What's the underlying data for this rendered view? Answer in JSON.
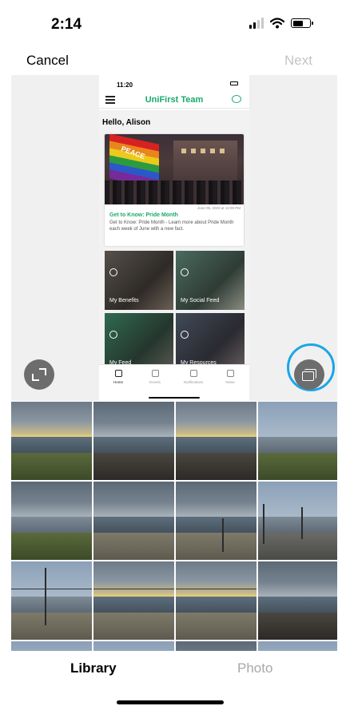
{
  "status_bar": {
    "time": "2:14"
  },
  "nav": {
    "cancel": "Cancel",
    "next": "Next"
  },
  "preview": {
    "status_time": "11:20",
    "app_title": "UniFirst Team",
    "greeting": "Hello, Alison",
    "card": {
      "flag_text": "PEACE",
      "date": "June 05, 2023 at 12:00 PM",
      "title": "Get to Know: Pride Month",
      "description": "Get to Know: Pride Month - Learn more about Pride Month each week of June with a new fact."
    },
    "tiles": [
      {
        "label": "My Benefits"
      },
      {
        "label": "My Social Feed"
      },
      {
        "label": "My Feed"
      },
      {
        "label": "My Resources"
      }
    ],
    "tabs": [
      {
        "label": "Home"
      },
      {
        "label": "Events"
      },
      {
        "label": "Notifications"
      },
      {
        "label": "News"
      }
    ]
  },
  "bottom_tabs": {
    "library": "Library",
    "photo": "Photo"
  },
  "colors": {
    "accent_green": "#1aaa6a",
    "highlight_ring": "#1aa6e6",
    "inactive_text": "#c4c4c4"
  },
  "icons": [
    "signal-icon",
    "wifi-icon",
    "battery-icon",
    "menu-icon",
    "chat-icon",
    "expand-icon",
    "multi-select-icon"
  ]
}
